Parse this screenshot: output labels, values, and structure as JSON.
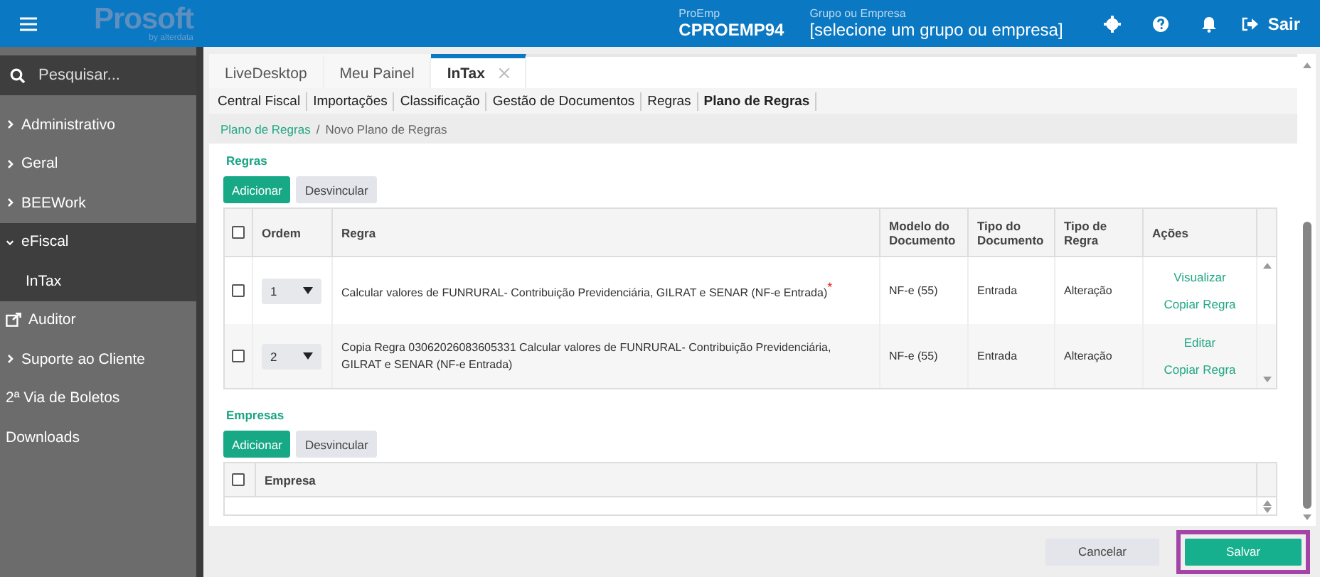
{
  "header": {
    "logo": "Prosoft",
    "logo_sub": "by alterdata",
    "proemp_label": "ProEmp",
    "proemp_value": "CPROEMP94",
    "group_label": "Grupo ou Empresa",
    "group_value": "[selecione um grupo ou empresa]",
    "exit": "Sair"
  },
  "sidebar": {
    "search_placeholder": "Pesquisar...",
    "items": [
      {
        "label": "Administrativo",
        "kind": "group",
        "expanded": false
      },
      {
        "label": "Geral",
        "kind": "group",
        "expanded": false
      },
      {
        "label": "BEEWork",
        "kind": "group",
        "expanded": false
      },
      {
        "label": "eFiscal",
        "kind": "group",
        "expanded": true,
        "children": [
          {
            "label": "InTax"
          }
        ]
      },
      {
        "label": "Auditor",
        "kind": "external"
      },
      {
        "label": "Suporte ao Cliente",
        "kind": "group",
        "expanded": false
      },
      {
        "label": "2ª Via de Boletos",
        "kind": "plain"
      },
      {
        "label": "Downloads",
        "kind": "plain"
      }
    ]
  },
  "tabs": [
    {
      "label": "LiveDesktop",
      "selected": false,
      "closable": false
    },
    {
      "label": "Meu Painel",
      "selected": false,
      "closable": false
    },
    {
      "label": "InTax",
      "selected": true,
      "closable": true
    }
  ],
  "subnav": [
    {
      "label": "Central Fiscal",
      "selected": false
    },
    {
      "label": "Importações",
      "selected": false
    },
    {
      "label": "Classificação",
      "selected": false
    },
    {
      "label": "Gestão de Documentos",
      "selected": false
    },
    {
      "label": "Regras",
      "selected": false
    },
    {
      "label": "Plano de Regras",
      "selected": true
    }
  ],
  "breadcrumb": {
    "link": "Plano de Regras",
    "separator": "/",
    "current": "Novo Plano de Regras"
  },
  "rules": {
    "title": "Regras",
    "buttons": [
      {
        "label": "Adicionar",
        "kind": "primary"
      },
      {
        "label": "Desvincular",
        "kind": "secondary"
      }
    ],
    "select_all_checked": false,
    "columns": [
      "Ordem",
      "Regra",
      "Modelo do Documento",
      "Tipo do Documento",
      "Tipo de Regra",
      "Ações"
    ],
    "rows": [
      {
        "checked": false,
        "order": "1",
        "rule": "Calcular valores de FUNRURAL- Contribuição Previdenciária, GILRAT e SENAR (NF-e Entrada)",
        "required_mark": "*",
        "model": "NF-e (55)",
        "doc_type": "Entrada",
        "rule_type": "Alteração",
        "actions": [
          "Visualizar",
          "Copiar Regra"
        ]
      },
      {
        "checked": false,
        "order": "2",
        "rule": "Copia Regra 03062026083605331 Calcular valores de FUNRURAL- Contribuição Previdenciária, GILRAT e SENAR (NF-e Entrada)",
        "model": "NF-e (55)",
        "doc_type": "Entrada",
        "rule_type": "Alteração",
        "actions": [
          "Editar",
          "Copiar Regra"
        ]
      }
    ]
  },
  "companies": {
    "title": "Empresas",
    "buttons": [
      {
        "label": "Adicionar",
        "kind": "primary"
      },
      {
        "label": "Desvincular",
        "kind": "secondary"
      }
    ],
    "select_all_checked": false,
    "columns": [
      "Empresa"
    ]
  },
  "footer": {
    "buttons": [
      {
        "label": "Cancelar",
        "kind": "secondary",
        "highlighted": false
      },
      {
        "label": "Salvar",
        "kind": "primary",
        "highlighted": true
      }
    ]
  }
}
